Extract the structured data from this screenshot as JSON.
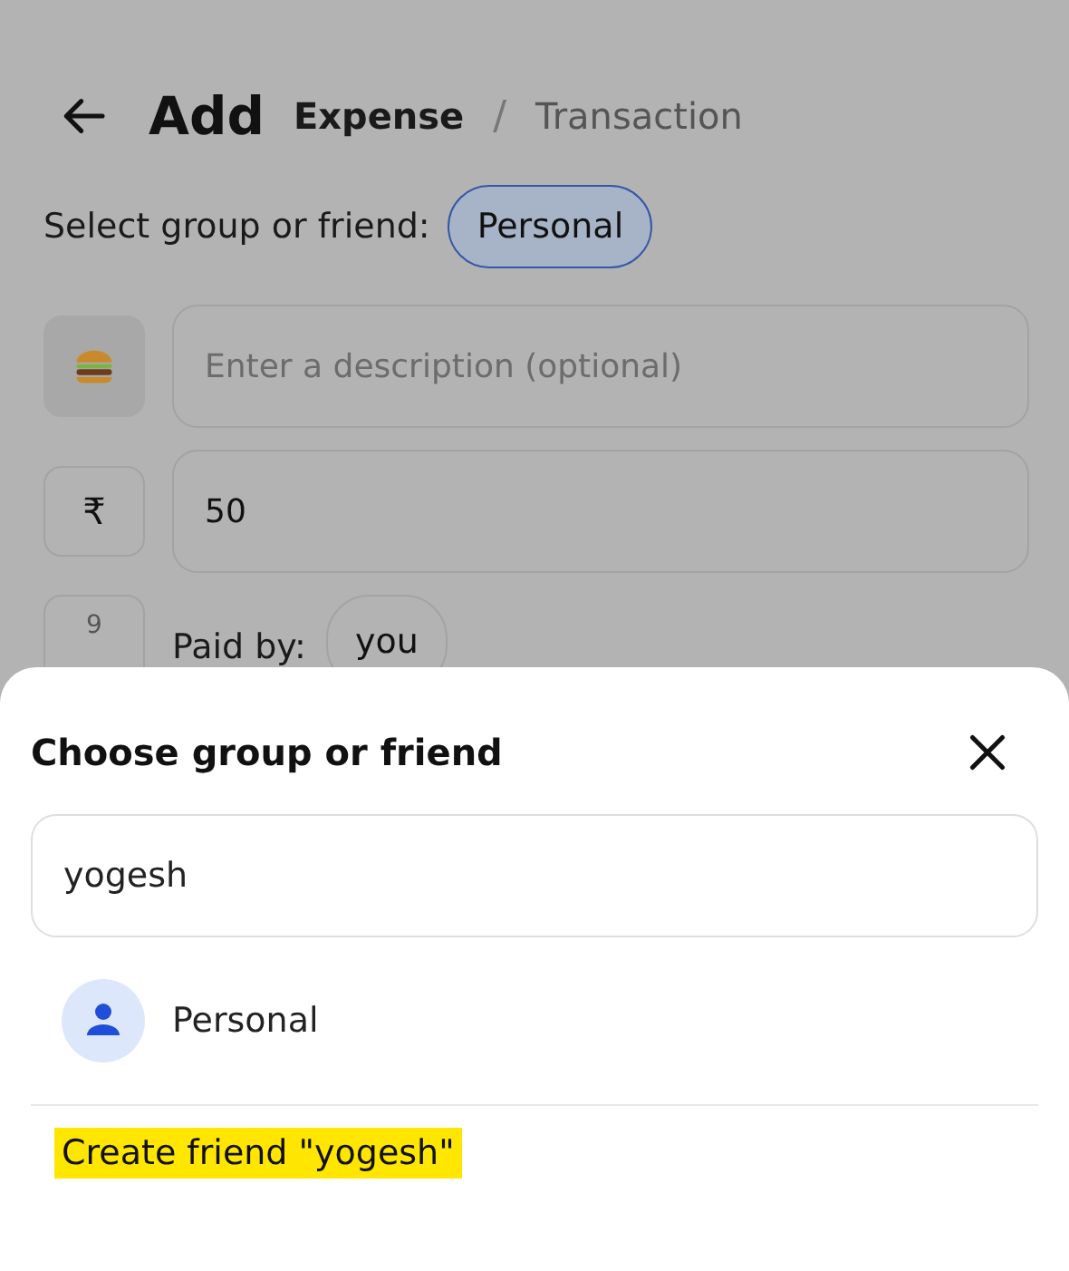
{
  "header": {
    "title": "Add",
    "separator": "/",
    "tabs": [
      {
        "label": "Expense",
        "selected": true
      },
      {
        "label": "Transaction",
        "selected": false
      }
    ]
  },
  "group_select": {
    "label": "Select group or friend:",
    "value": "Personal"
  },
  "description": {
    "placeholder": "Enter a description (optional)"
  },
  "amount": {
    "currency": "₹",
    "value": "50"
  },
  "paid_by": {
    "date": "9",
    "label": "Paid by:",
    "value": "you"
  },
  "sheet": {
    "title": "Choose group or friend",
    "search": {
      "value": "yogesh"
    },
    "results": [
      {
        "label": "Personal"
      }
    ],
    "create": {
      "label": "Create friend \"yogesh\"",
      "highlighted": true
    }
  }
}
